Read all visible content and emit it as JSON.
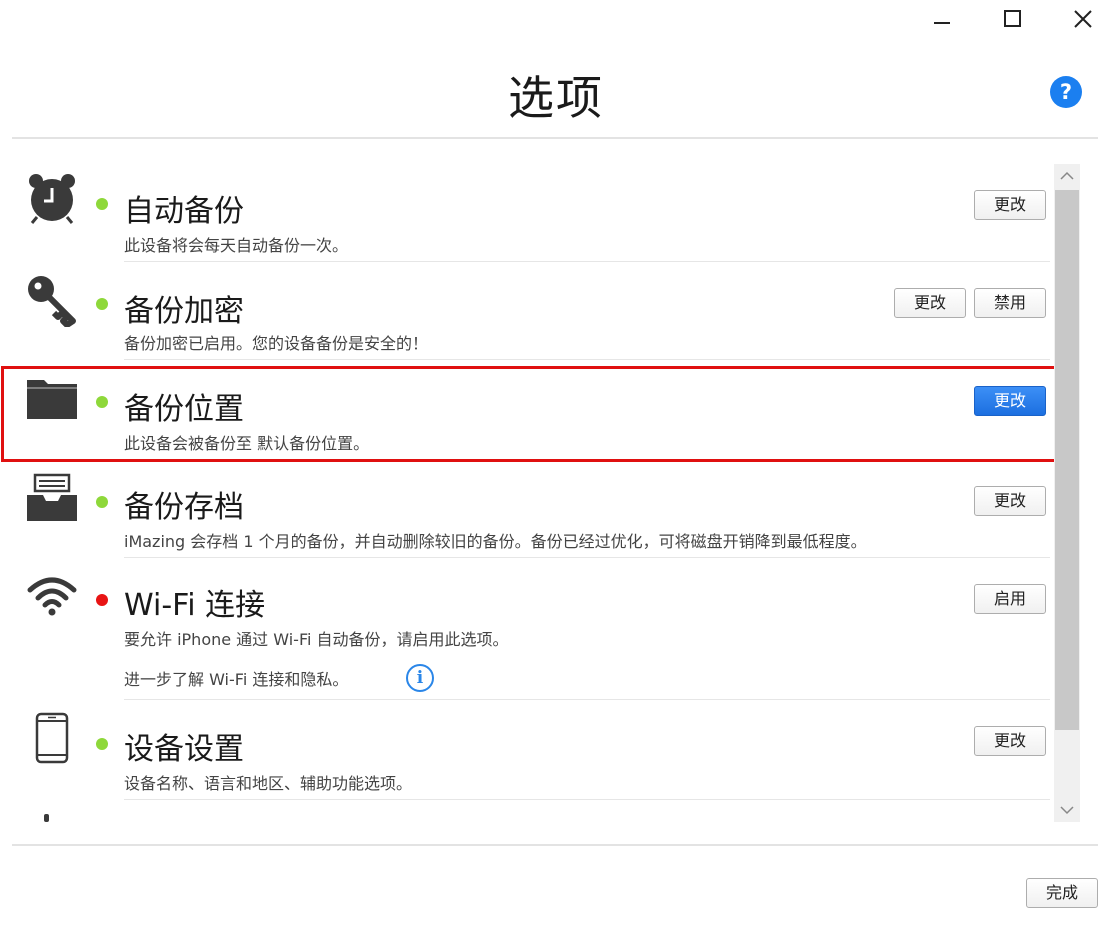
{
  "window": {
    "title": "选项",
    "controls": {
      "minimize": "minimize-icon",
      "maximize": "maximize-icon",
      "close": "close-icon"
    }
  },
  "help": {
    "label": "?",
    "icon": "help-icon",
    "color": "#1b7ff0"
  },
  "status_colors": {
    "on": "#8ed83a",
    "off": "#e81414"
  },
  "options": [
    {
      "id": "auto-backup",
      "icon": "alarm-clock-icon",
      "status": "on",
      "name": "自动备份",
      "desc": "此设备将会每天自动备份一次。",
      "buttons": [
        "更改"
      ]
    },
    {
      "id": "backup-encryption",
      "icon": "key-icon",
      "status": "on",
      "name": "备份加密",
      "desc": "备份加密已启用。您的设备备份是安全的！",
      "buttons": [
        "更改",
        "禁用"
      ]
    },
    {
      "id": "backup-location",
      "icon": "folder-icon",
      "status": "on",
      "name": "备份位置",
      "desc": "此设备会被备份至 默认备份位置。",
      "buttons": [
        "更改"
      ],
      "highlighted": true
    },
    {
      "id": "backup-archive",
      "icon": "archive-tray-icon",
      "status": "on",
      "name": "备份存档",
      "desc": "iMazing 会存档 1 个月的备份，并自动删除较旧的备份。备份已经过优化，可将磁盘开销降到最低程度。",
      "buttons": [
        "更改"
      ]
    },
    {
      "id": "wifi",
      "icon": "wifi-icon",
      "status": "off",
      "name": "Wi-Fi 连接",
      "desc": "要允许 iPhone 通过 Wi-Fi 自动备份，请启用此选项。",
      "desc2": "进一步了解 Wi-Fi 连接和隐私。",
      "info": "i",
      "buttons": [
        "启用"
      ]
    },
    {
      "id": "device-settings",
      "icon": "phone-icon",
      "status": "on",
      "name": "设备设置",
      "desc": "设备名称、语言和地区、辅助功能选项。",
      "buttons": [
        "更改"
      ]
    }
  ],
  "footer": {
    "done_label": "完成"
  }
}
